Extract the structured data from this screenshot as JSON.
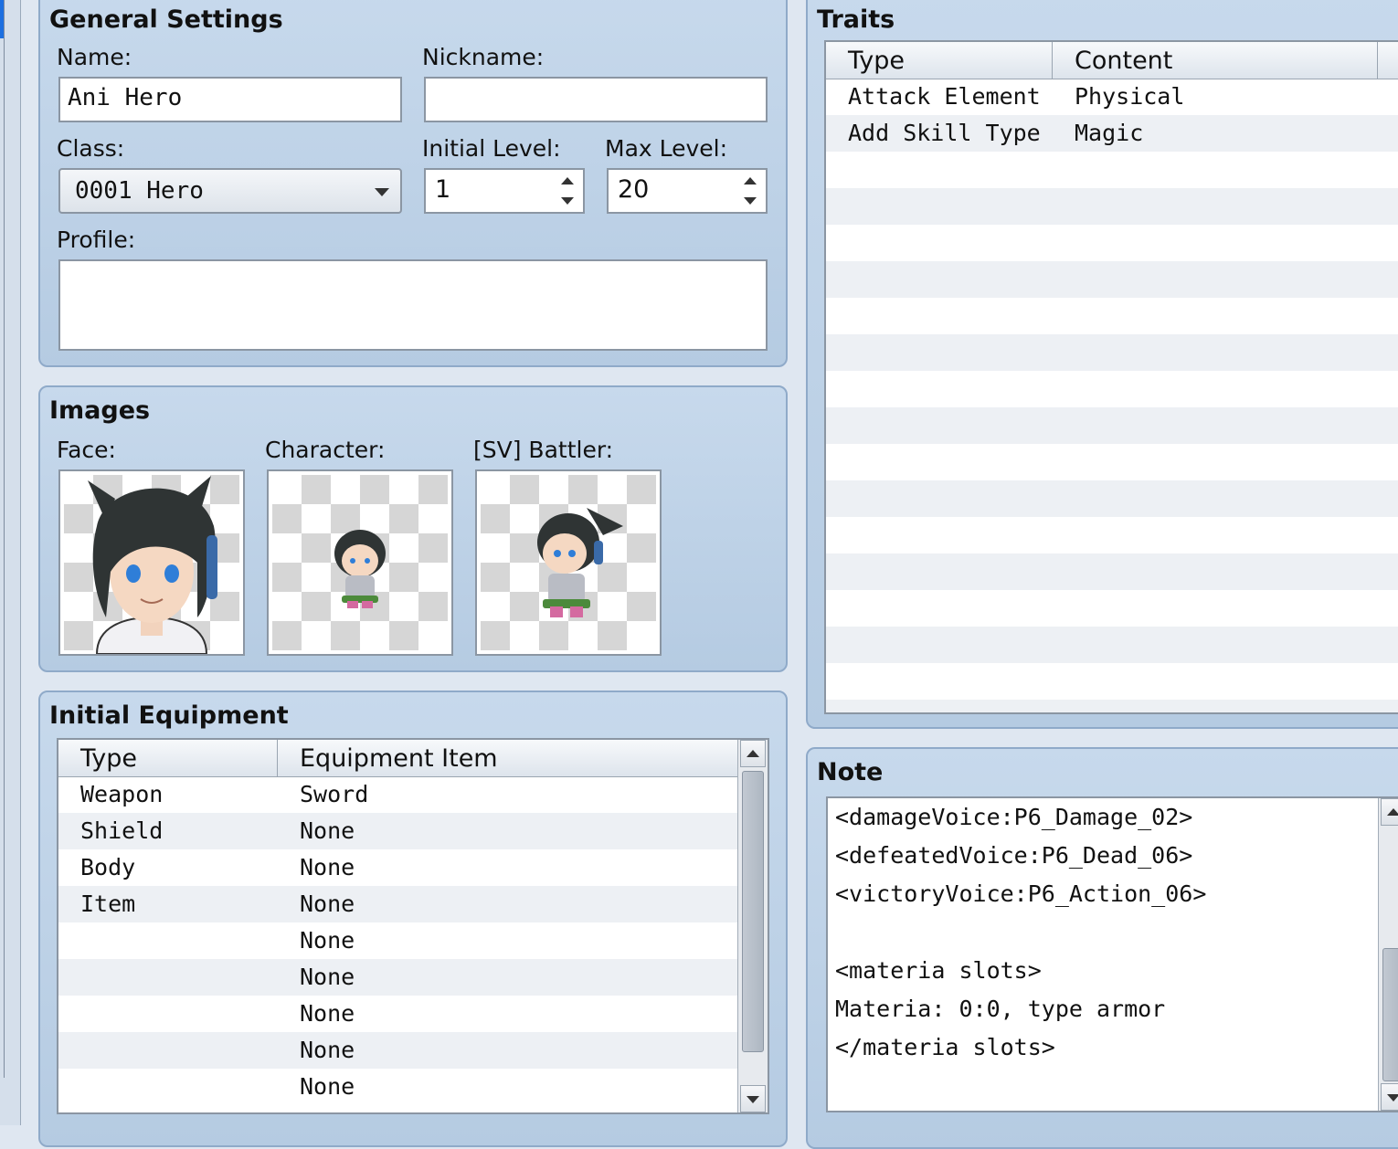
{
  "general": {
    "title": "General Settings",
    "name_label": "Name:",
    "name_value": "Ani Hero",
    "nickname_label": "Nickname:",
    "nickname_value": "",
    "class_label": "Class:",
    "class_value": "0001 Hero",
    "initial_level_label": "Initial Level:",
    "initial_level_value": "1",
    "max_level_label": "Max Level:",
    "max_level_value": "20",
    "profile_label": "Profile:",
    "profile_value": ""
  },
  "images": {
    "title": "Images",
    "face_label": "Face:",
    "character_label": "Character:",
    "battler_label": "[SV] Battler:"
  },
  "equipment": {
    "title": "Initial Equipment",
    "columns": [
      "Type",
      "Equipment Item"
    ],
    "rows": [
      {
        "type": "Weapon",
        "item": "Sword"
      },
      {
        "type": "Shield",
        "item": "None"
      },
      {
        "type": "Body",
        "item": "None"
      },
      {
        "type": "Item",
        "item": "None"
      },
      {
        "type": "",
        "item": "None"
      },
      {
        "type": "",
        "item": "None"
      },
      {
        "type": "",
        "item": "None"
      },
      {
        "type": "",
        "item": "None"
      },
      {
        "type": "",
        "item": "None"
      }
    ]
  },
  "traits": {
    "title": "Traits",
    "columns": [
      "Type",
      "Content"
    ],
    "rows": [
      {
        "type": "Attack Element",
        "content": "Physical"
      },
      {
        "type": "Add Skill Type",
        "content": "Magic"
      }
    ]
  },
  "note": {
    "title": "Note",
    "lines": [
      "<damageVoice:P6_Damage_02>",
      "<defeatedVoice:P6_Dead_06>",
      "<victoryVoice:P6_Action_06>",
      "",
      "<materia slots>",
      "Materia: 0:0, type armor",
      "</materia slots>"
    ]
  },
  "colors": {
    "panel": "#c7d9ec",
    "panel_border": "#8faac9",
    "row_alt": "#edf0f4",
    "accent": "#1d6fe0"
  }
}
